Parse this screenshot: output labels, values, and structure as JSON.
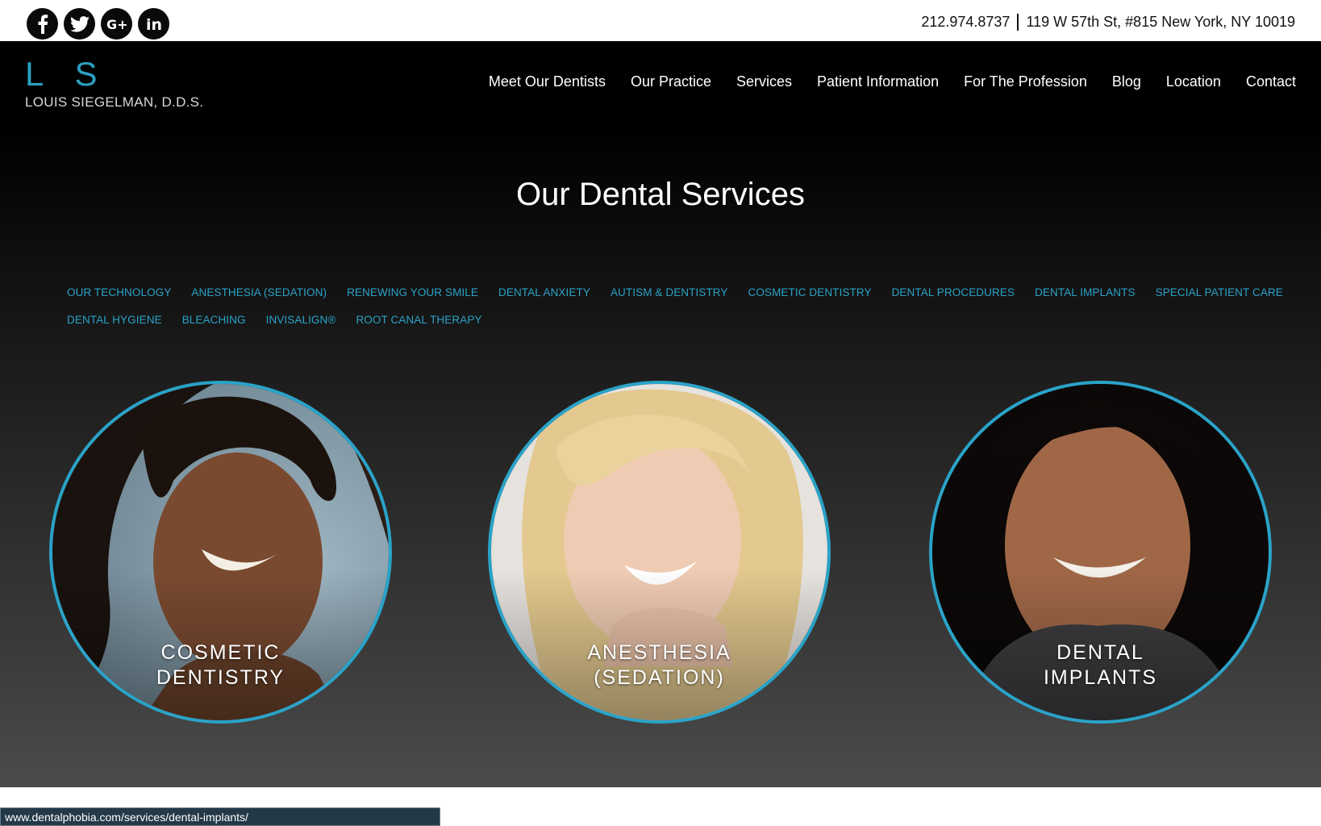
{
  "topbar": {
    "social": [
      {
        "name": "facebook-icon",
        "glyph": "f"
      },
      {
        "name": "twitter-icon",
        "glyph": "bird"
      },
      {
        "name": "google-plus-icon",
        "glyph": "G+"
      },
      {
        "name": "linkedin-icon",
        "glyph": "in"
      }
    ],
    "phone": "212.974.8737",
    "address": "119 W 57th St, #815 New York, NY 10019"
  },
  "logo": {
    "mark": "L S",
    "name": "LOUIS SIEGELMAN, D.D.S."
  },
  "nav": [
    "Meet Our Dentists",
    "Our Practice",
    "Services",
    "Patient Information",
    "For The Profession",
    "Blog",
    "Location",
    "Contact"
  ],
  "page_title": "Our Dental Services",
  "service_links": [
    [
      "OUR TECHNOLOGY",
      "ANESTHESIA (SEDATION)",
      "RENEWING YOUR SMILE",
      "DENTAL ANXIETY",
      "AUTISM & DENTISTRY",
      "COSMETIC DENTISTRY",
      "DENTAL PROCEDURES",
      "DENTAL IMPLANTS",
      "SPECIAL PATIENT CARE"
    ],
    [
      "DENTAL HYGIENE",
      "BLEACHING",
      "INVISALIGN®",
      "ROOT CANAL THERAPY"
    ]
  ],
  "featured": [
    {
      "line1": "COSMETIC",
      "line2": "DENTISTRY"
    },
    {
      "line1": "ANESTHESIA",
      "line2": "(SEDATION)"
    },
    {
      "line1": "DENTAL",
      "line2": "IMPLANTS"
    }
  ],
  "status_url": "www.dentalphobia.com/services/dental-implants/",
  "colors": {
    "accent": "#2aa3c8",
    "header_bg": "#000000",
    "status_bar_bg": "#233947"
  }
}
